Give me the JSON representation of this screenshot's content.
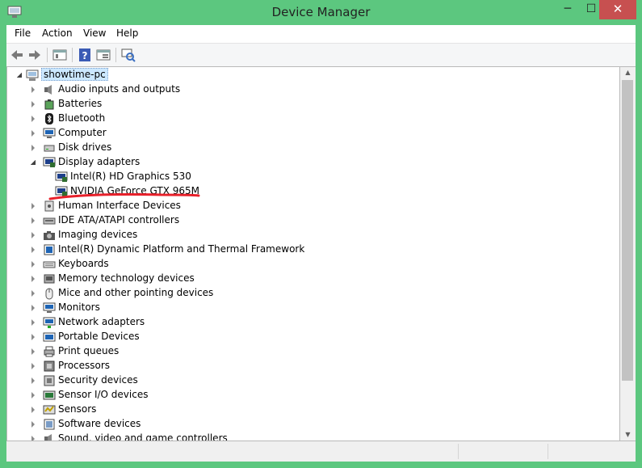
{
  "window": {
    "title": "Device Manager"
  },
  "title_buttons": {
    "minimize": "─",
    "maximize": "☐",
    "close": "✕"
  },
  "menu": [
    "File",
    "Action",
    "View",
    "Help"
  ],
  "toolbar_icons": [
    "back-arrow-icon",
    "forward-arrow-icon",
    "properties-pane-icon",
    "help-icon",
    "view-pane-icon",
    "scan-hardware-icon"
  ],
  "tree": {
    "root": {
      "label": "showtime-pc",
      "icon": "computer-icon"
    },
    "rows": [
      {
        "label": "Audio inputs and outputs",
        "icon": "speaker-icon",
        "level": 1,
        "expander": "closed"
      },
      {
        "label": "Batteries",
        "icon": "battery-icon",
        "level": 1,
        "expander": "closed"
      },
      {
        "label": "Bluetooth",
        "icon": "bluetooth-icon",
        "level": 1,
        "expander": "closed"
      },
      {
        "label": "Computer",
        "icon": "monitor-icon",
        "level": 1,
        "expander": "closed"
      },
      {
        "label": "Disk drives",
        "icon": "disk-drive-icon",
        "level": 1,
        "expander": "closed"
      },
      {
        "label": "Display adapters",
        "icon": "display-adapter-icon",
        "level": 1,
        "expander": "open"
      },
      {
        "label": "Intel(R) HD Graphics 530",
        "icon": "display-adapter-icon",
        "level": 2,
        "expander": "none"
      },
      {
        "label": "NVIDIA GeForce GTX 965M",
        "icon": "display-adapter-icon",
        "level": 2,
        "expander": "none"
      },
      {
        "label": "Human Interface Devices",
        "icon": "hid-icon",
        "level": 1,
        "expander": "closed"
      },
      {
        "label": "IDE ATA/ATAPI controllers",
        "icon": "ide-controller-icon",
        "level": 1,
        "expander": "closed"
      },
      {
        "label": "Imaging devices",
        "icon": "camera-icon",
        "level": 1,
        "expander": "closed"
      },
      {
        "label": "Intel(R) Dynamic Platform and Thermal Framework",
        "icon": "chip-icon",
        "level": 1,
        "expander": "closed"
      },
      {
        "label": "Keyboards",
        "icon": "keyboard-icon",
        "level": 1,
        "expander": "closed"
      },
      {
        "label": "Memory technology devices",
        "icon": "memory-icon",
        "level": 1,
        "expander": "closed"
      },
      {
        "label": "Mice and other pointing devices",
        "icon": "mouse-icon",
        "level": 1,
        "expander": "closed"
      },
      {
        "label": "Monitors",
        "icon": "monitor-icon",
        "level": 1,
        "expander": "closed"
      },
      {
        "label": "Network adapters",
        "icon": "network-icon",
        "level": 1,
        "expander": "closed"
      },
      {
        "label": "Portable Devices",
        "icon": "portable-device-icon",
        "level": 1,
        "expander": "closed"
      },
      {
        "label": "Print queues",
        "icon": "printer-icon",
        "level": 1,
        "expander": "closed"
      },
      {
        "label": "Processors",
        "icon": "processor-icon",
        "level": 1,
        "expander": "closed"
      },
      {
        "label": "Security devices",
        "icon": "security-icon",
        "level": 1,
        "expander": "closed"
      },
      {
        "label": "Sensor I/O devices",
        "icon": "sensor-io-icon",
        "level": 1,
        "expander": "closed"
      },
      {
        "label": "Sensors",
        "icon": "sensor-icon",
        "level": 1,
        "expander": "closed"
      },
      {
        "label": "Software devices",
        "icon": "software-device-icon",
        "level": 1,
        "expander": "closed"
      },
      {
        "label": "Sound, video and game controllers",
        "icon": "sound-icon",
        "level": 1,
        "expander": "closed"
      }
    ]
  },
  "annotation": {
    "color": "#e8202a",
    "marks": "NVIDIA GeForce GTX 965M"
  },
  "colors": {
    "window_frame": "#5cc77f",
    "close_button": "#c75050",
    "selection": "#cce8ff"
  }
}
